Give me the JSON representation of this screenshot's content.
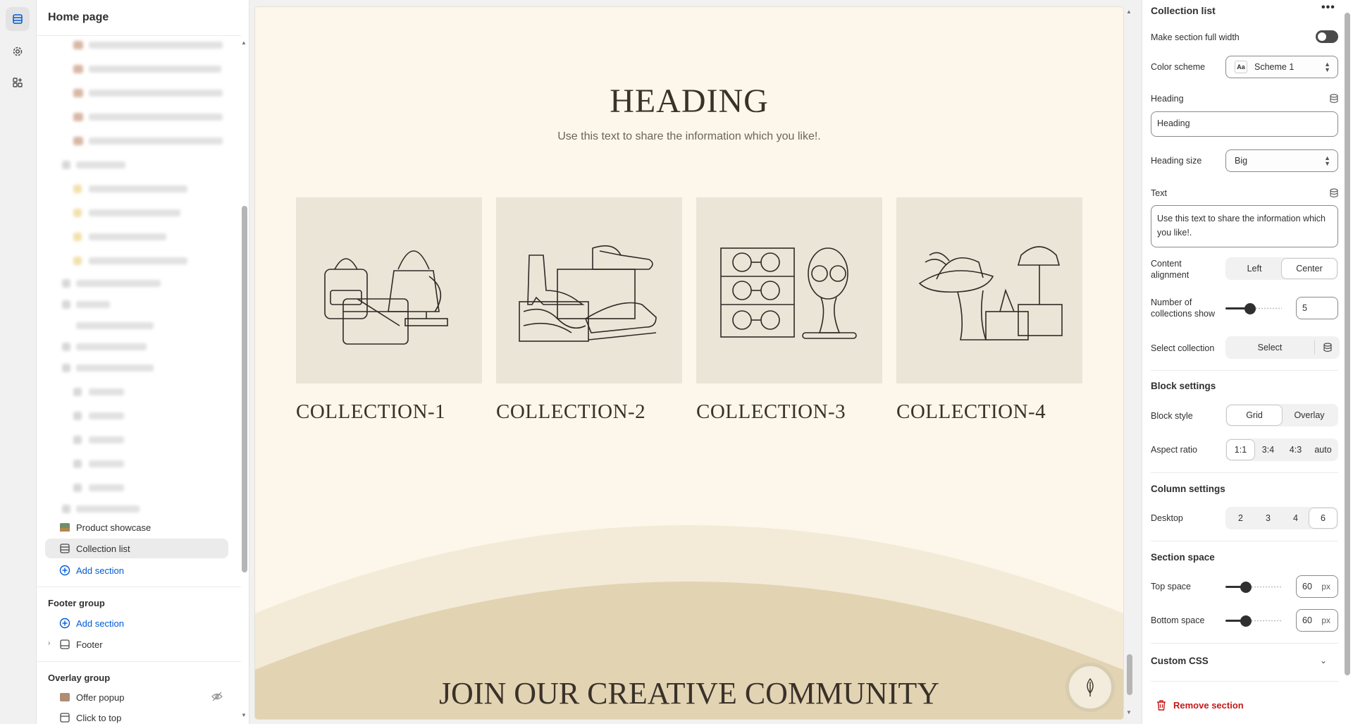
{
  "app": {
    "page_title": "Home page"
  },
  "sections": {
    "product_showcase": "Product showcase",
    "collection_list": "Collection list",
    "add_section": "Add section"
  },
  "footer_group": {
    "title": "Footer group",
    "add_section": "Add section",
    "footer": "Footer"
  },
  "overlay_group": {
    "title": "Overlay group",
    "offer_popup": "Offer popup",
    "click_to_top": "Click to top"
  },
  "preview": {
    "heading": "HEADING",
    "text": "Use this text to share the information which you like!.",
    "collections": [
      "COLLECTION-1",
      "COLLECTION-2",
      "COLLECTION-3",
      "COLLECTION-4"
    ],
    "join_heading": "JOIN OUR CREATIVE COMMUNITY",
    "bg_color": "#fcf7ea",
    "wave_light": "#f1e8d4",
    "wave_dark": "#e2d3b3"
  },
  "settings": {
    "title": "Collection list",
    "more": "•••",
    "full_width_label": "Make section full width",
    "full_width_on": false,
    "color_scheme_label": "Color scheme",
    "color_scheme_value": "Scheme 1",
    "color_scheme_icon": "Aa",
    "heading_label": "Heading",
    "heading_value": "Heading",
    "heading_size_label": "Heading size",
    "heading_size_value": "Big",
    "text_label": "Text",
    "text_value": "Use this text to share the information which you like!.",
    "content_alignment_label": "Content alignment",
    "alignment_options": [
      "Left",
      "Center"
    ],
    "alignment_selected": "Center",
    "num_collections_label": "Number of collections show",
    "num_collections_value": "5",
    "select_collection_label": "Select collection",
    "select_button": "Select",
    "block_settings_title": "Block settings",
    "block_style_label": "Block style",
    "block_style_options": [
      "Grid",
      "Overlay"
    ],
    "block_style_selected": "Grid",
    "aspect_ratio_label": "Aspect ratio",
    "aspect_ratio_options": [
      "1:1",
      "3:4",
      "4:3",
      "auto"
    ],
    "aspect_ratio_selected": "1:1",
    "column_settings_title": "Column settings",
    "desktop_label": "Desktop",
    "desktop_options": [
      "2",
      "3",
      "4",
      "6"
    ],
    "desktop_selected": "6",
    "section_space_title": "Section space",
    "top_space_label": "Top space",
    "top_space_value": "60",
    "bottom_space_label": "Bottom space",
    "bottom_space_value": "60",
    "unit": "px",
    "custom_css_label": "Custom CSS",
    "remove_section": "Remove section",
    "remove_color": "#c41919"
  }
}
